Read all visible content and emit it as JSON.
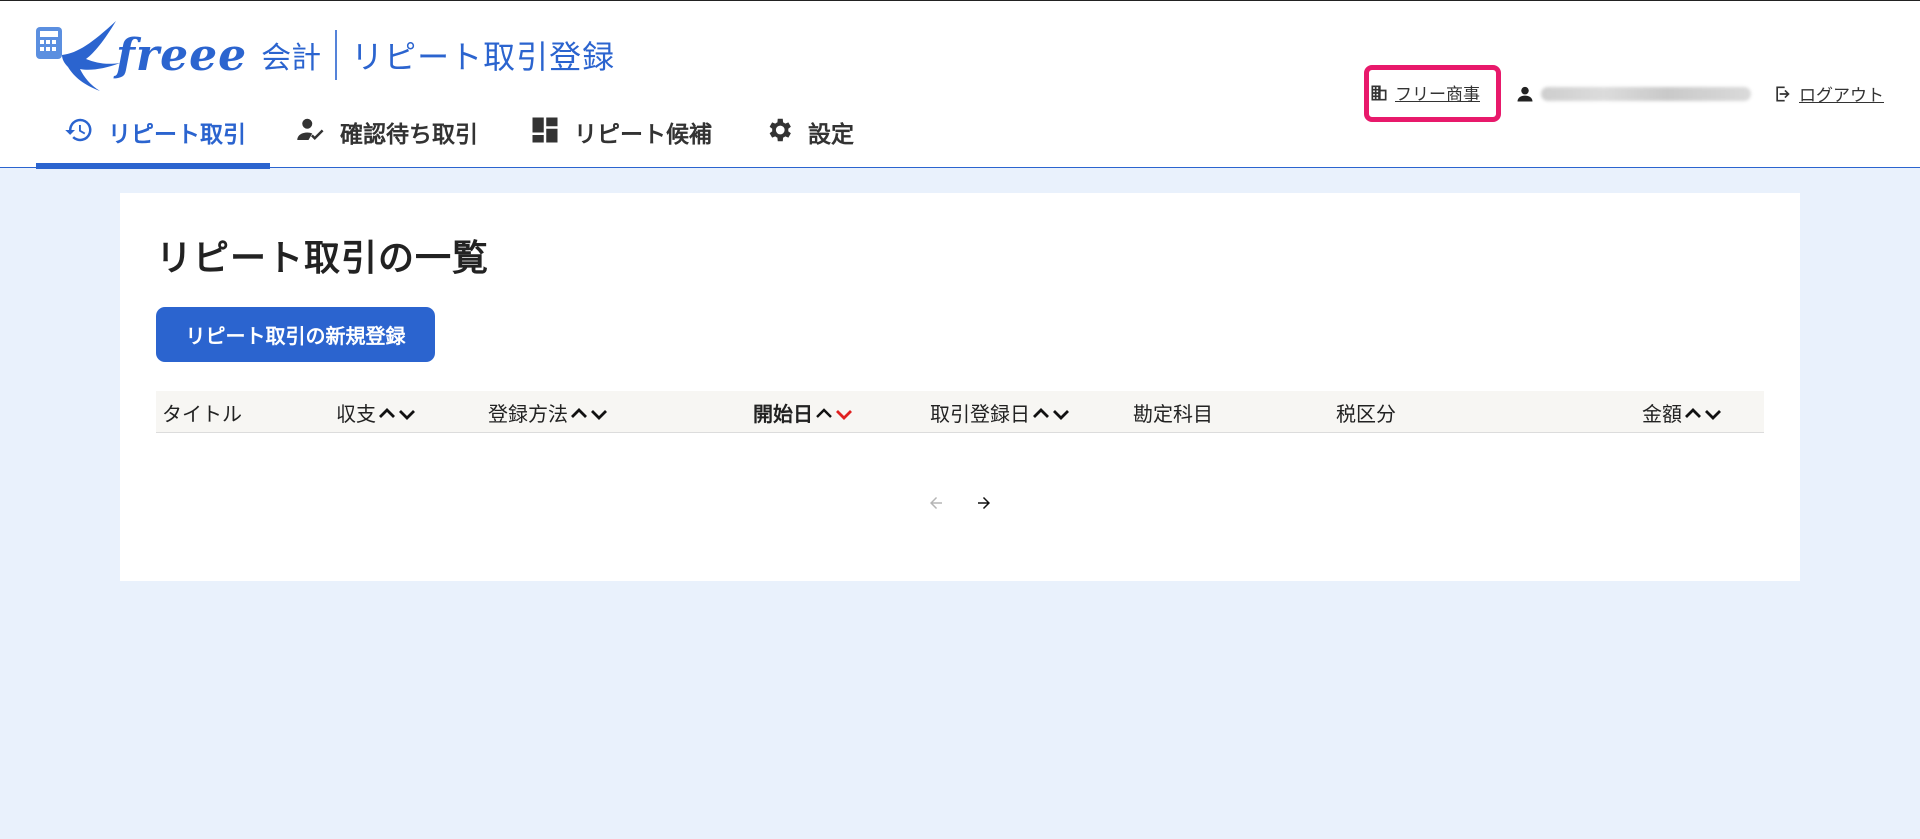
{
  "logo": {
    "word": "freee",
    "product": "会計",
    "page_name": "リピート取引登録"
  },
  "nav": {
    "items": [
      {
        "label": "リピート取引",
        "icon": "history-icon",
        "active": true
      },
      {
        "label": "確認待ち取引",
        "icon": "user-check-icon",
        "active": false
      },
      {
        "label": "リピート候補",
        "icon": "dashboard-icon",
        "active": false
      },
      {
        "label": "設定",
        "icon": "gear-icon",
        "active": false
      }
    ]
  },
  "topbar": {
    "company": "フリー商事",
    "logout": "ログアウト"
  },
  "main": {
    "title": "リピート取引の一覧",
    "new_button": "リピート取引の新規登録",
    "columns": [
      {
        "label": "タイトル",
        "sortable": false
      },
      {
        "label": "収支",
        "sortable": true
      },
      {
        "label": "登録方法",
        "sortable": true
      },
      {
        "label": "開始日",
        "sortable": true,
        "active_sort": "desc"
      },
      {
        "label": "取引登録日",
        "sortable": true
      },
      {
        "label": "勘定科目",
        "sortable": false
      },
      {
        "label": "税区分",
        "sortable": false
      },
      {
        "label": "金額",
        "sortable": true
      }
    ]
  },
  "colors": {
    "brand": "#2b64cf",
    "highlight": "#e8196b",
    "sort_active": "#e02020",
    "page_bg": "#e9f1fc"
  }
}
